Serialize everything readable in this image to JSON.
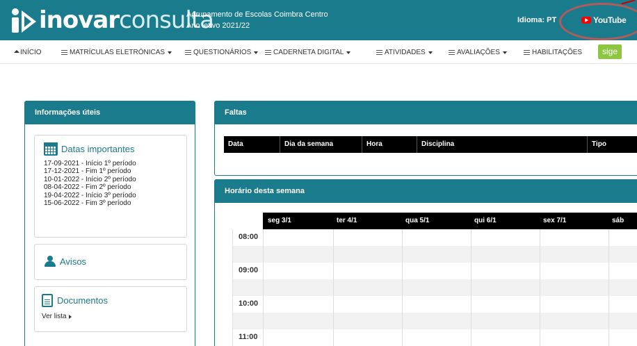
{
  "header": {
    "logo_bold": "inovar",
    "logo_light": "consulta",
    "school_name": "Agrupamento de Escolas Coimbra Centro",
    "school_year": "Ano letivo 2021/22",
    "language_label": "Idioma: PT",
    "youtube_label": "YouTube",
    "brand_color": "#1a7b8c"
  },
  "nav": {
    "items": [
      {
        "label": "INÍCIO",
        "icon": "home-icon"
      },
      {
        "label": "MATRÍCULAS ELETRÓNICAS",
        "icon": "list-icon",
        "dropdown": true
      },
      {
        "label": "QUESTIONÁRIOS",
        "icon": "list-icon",
        "dropdown": true
      },
      {
        "label": "CADERNETA DIGITAL",
        "icon": "list-icon",
        "dropdown": true
      },
      {
        "label": "ATIVIDADES",
        "icon": "list-icon",
        "dropdown": true
      },
      {
        "label": "AVALIAÇÕES",
        "icon": "list-icon",
        "dropdown": true
      },
      {
        "label": "HABILITAÇÕES",
        "icon": "list-icon",
        "dropdown": false
      }
    ],
    "sige_label": "sige"
  },
  "info_panel": {
    "title": "Informações úteis",
    "datas_title": "Datas importantes",
    "dates": [
      "17-09-2021 - Início 1º período",
      "17-12-2021 - Fim 1º período",
      "10-01-2022 - Início 2º período",
      "08-04-2022 - Fim 2º período",
      "19-04-2022 - Início 3º período",
      "15-06-2022 - Fim 3º período"
    ],
    "avisos_title": "Avisos",
    "documentos_title": "Documentos",
    "ver_lista": "Ver lista"
  },
  "faltas": {
    "title": "Faltas",
    "columns": [
      "Data",
      "Dia da semana",
      "Hora",
      "Disciplina",
      "Tipo"
    ]
  },
  "horario": {
    "title": "Horário desta semana",
    "days": [
      "seg 3/1",
      "ter 4/1",
      "qua 5/1",
      "qui 6/1",
      "sex 7/1",
      "sáb"
    ],
    "times": [
      "08:00",
      "09:00",
      "10:00",
      "11:00"
    ]
  }
}
